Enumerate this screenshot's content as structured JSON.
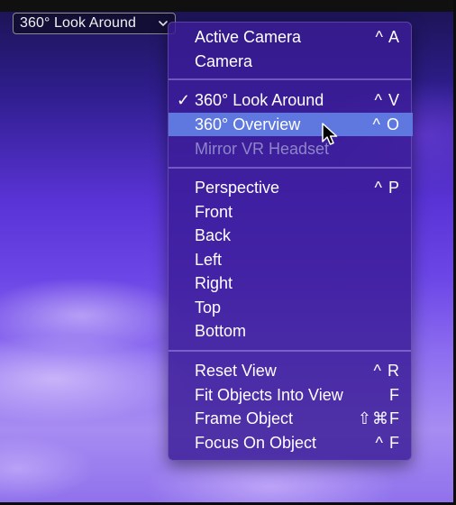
{
  "viewport": {
    "popup_label": "360° Look Around"
  },
  "menu": {
    "groups": [
      [
        {
          "label": "Active Camera",
          "shortcut": "^ A"
        },
        {
          "label": "Camera",
          "shortcut": ""
        }
      ],
      [
        {
          "label": "360° Look Around",
          "shortcut": "^ V",
          "checked": true
        },
        {
          "label": "360° Overview",
          "shortcut": "^ O",
          "highlighted": true
        },
        {
          "label": "Mirror VR Headset",
          "shortcut": "",
          "disabled": true
        }
      ],
      [
        {
          "label": "Perspective",
          "shortcut": "^ P"
        },
        {
          "label": "Front",
          "shortcut": ""
        },
        {
          "label": "Back",
          "shortcut": ""
        },
        {
          "label": "Left",
          "shortcut": ""
        },
        {
          "label": "Right",
          "shortcut": ""
        },
        {
          "label": "Top",
          "shortcut": ""
        },
        {
          "label": "Bottom",
          "shortcut": ""
        }
      ],
      [
        {
          "label": "Reset View",
          "shortcut": "^ R"
        },
        {
          "label": "Fit Objects Into View",
          "shortcut": "F"
        },
        {
          "label": "Frame Object",
          "shortcut": "⇧⌘F"
        },
        {
          "label": "Focus On Object",
          "shortcut": "^ F"
        }
      ]
    ],
    "check_mark": "✓"
  },
  "icons": {
    "popup_chevron": "chevron-down-icon",
    "cursor": "arrow-pointer-icon"
  }
}
